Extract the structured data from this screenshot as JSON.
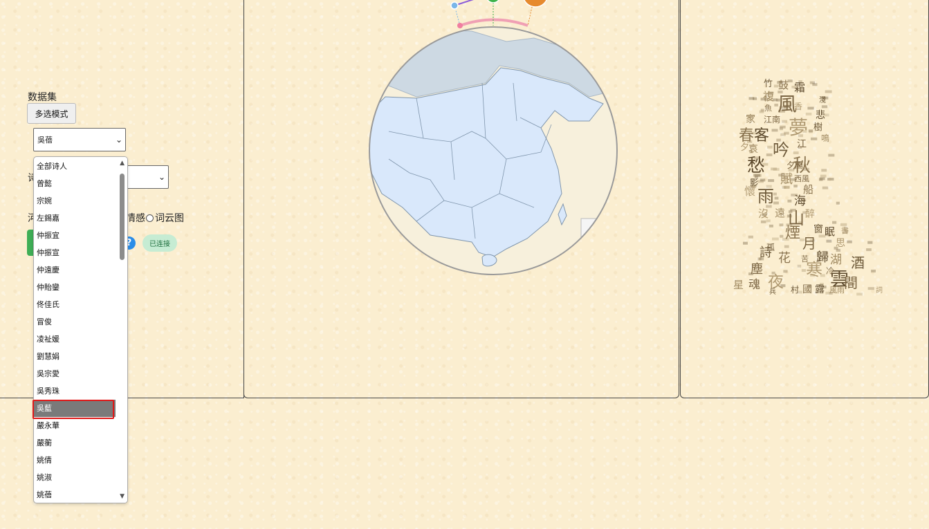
{
  "controls": {
    "dataset_label": "数据集",
    "multi_select_label": "多选模式",
    "poet_selected": "吳蓓",
    "partial_label_1": "诗",
    "partial_label_2": "河",
    "option_sentiment": "情感",
    "option_wordcloud": "词云图",
    "help_icon_text": "?",
    "status_badge": "已连接"
  },
  "dropdown": {
    "options": [
      "全部诗人",
      "曾懿",
      "宗婉",
      "左錫嘉",
      "仲振宜",
      "仲振宣",
      "仲遠慶",
      "仲貽鑾",
      "佟佳氏",
      "冒俊",
      "凌祉媛",
      "劉慧娟",
      "吳宗愛",
      "吳秀珠",
      "吳藍",
      "嚴永華",
      "嚴蘅",
      "姚倩",
      "姚淑",
      "姚蓓"
    ],
    "highlighted": "吳藍"
  },
  "map": {
    "accent_colors": [
      "#7ab6e8",
      "#8c5cd9",
      "#3cb34a",
      "#e68a2e",
      "#f0a0b4"
    ]
  },
  "wordcloud": {
    "words": [
      {
        "t": "竹"
      },
      {
        "t": "鼓"
      },
      {
        "t": "霜"
      },
      {
        "t": "複"
      },
      {
        "t": "風"
      },
      {
        "t": "香"
      },
      {
        "t": "淺"
      },
      {
        "t": "魚"
      },
      {
        "t": "悲"
      },
      {
        "t": "家"
      },
      {
        "t": "江南"
      },
      {
        "t": "夢"
      },
      {
        "t": "樹"
      },
      {
        "t": "春"
      },
      {
        "t": "客"
      },
      {
        "t": "鳴"
      },
      {
        "t": "江"
      },
      {
        "t": "夕"
      },
      {
        "t": "吟"
      },
      {
        "t": "秋"
      },
      {
        "t": "愁"
      },
      {
        "t": "賦"
      },
      {
        "t": "夕陽"
      },
      {
        "t": "懷"
      },
      {
        "t": "雨"
      },
      {
        "t": "船"
      },
      {
        "t": "海"
      },
      {
        "t": "遠"
      },
      {
        "t": "山"
      },
      {
        "t": "醉"
      },
      {
        "t": "窗"
      },
      {
        "t": "煙"
      },
      {
        "t": "眠"
      },
      {
        "t": "書"
      },
      {
        "t": "月"
      },
      {
        "t": "思"
      },
      {
        "t": "詩"
      },
      {
        "t": "花"
      },
      {
        "t": "歸"
      },
      {
        "t": "湖"
      },
      {
        "t": "塵"
      },
      {
        "t": "寒"
      },
      {
        "t": "酒"
      },
      {
        "t": "冷"
      },
      {
        "t": "雲"
      },
      {
        "t": "星"
      },
      {
        "t": "魂"
      },
      {
        "t": "夜"
      },
      {
        "t": "村"
      },
      {
        "t": "國"
      },
      {
        "t": "露"
      },
      {
        "t": "風雨"
      },
      {
        "t": "間"
      },
      {
        "t": "詞"
      },
      {
        "t": "孤"
      },
      {
        "t": "苦"
      },
      {
        "t": "影"
      },
      {
        "t": "哀"
      },
      {
        "t": "西風"
      },
      {
        "t": "沒"
      },
      {
        "t": "兵"
      }
    ]
  }
}
